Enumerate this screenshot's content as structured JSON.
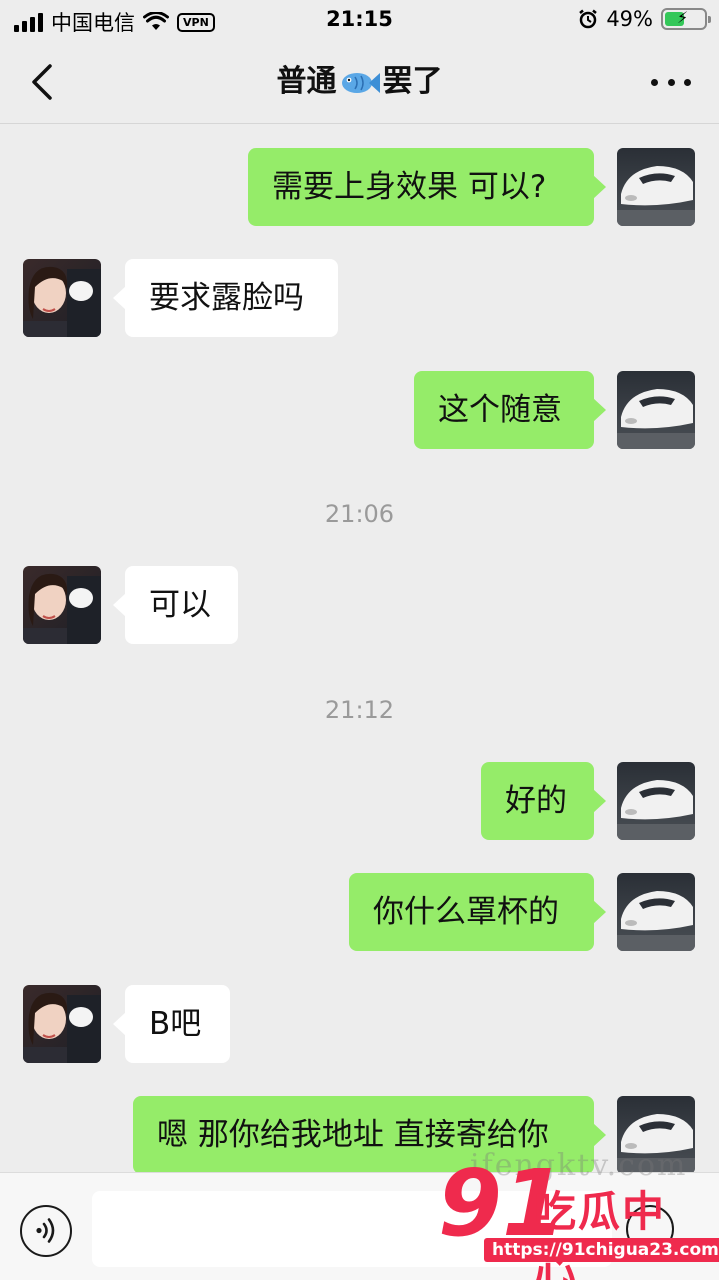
{
  "status_bar": {
    "carrier": "中国电信",
    "vpn": "VPN",
    "time": "21:15",
    "battery_percent": "49%",
    "battery_level": 0.49
  },
  "nav": {
    "title_before": "普通",
    "title_after": "罢了"
  },
  "messages": [
    {
      "side": "out",
      "text": "需要上身效果 可以?"
    },
    {
      "side": "in",
      "text": "要求露脸吗"
    },
    {
      "side": "out",
      "text": "这个随意"
    },
    {
      "type": "time",
      "text": "21:06"
    },
    {
      "side": "in",
      "text": "可以"
    },
    {
      "type": "time",
      "text": "21:12"
    },
    {
      "side": "out",
      "text": "好的"
    },
    {
      "side": "out",
      "text": "你什么罩杯的"
    },
    {
      "side": "in",
      "text": "B吧"
    },
    {
      "side": "out",
      "text": "嗯 那你给我地址 直接寄给你"
    }
  ],
  "input": {
    "value": ""
  },
  "watermark": {
    "site_text": "ifengktv.com",
    "logo_number": "91",
    "logo_text": "吃瓜中心",
    "logo_url": "https://91chigua23.com"
  },
  "colors": {
    "outgoing_bubble": "#95ec69",
    "incoming_bubble": "#ffffff",
    "background": "#ededed",
    "watermark_red": "#ef2a4d"
  },
  "icons": [
    "back-arrow-icon",
    "fish-emoji-icon",
    "more-dots-icon",
    "voice-icon",
    "emoji-icon",
    "wifi-icon",
    "alarm-icon"
  ]
}
